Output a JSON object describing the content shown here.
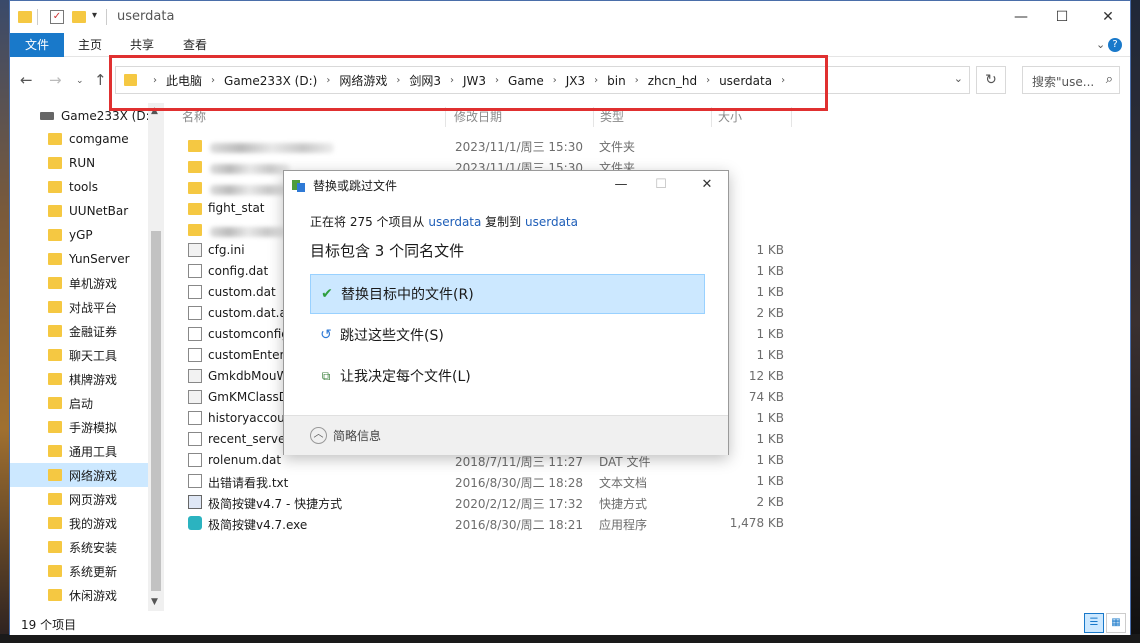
{
  "window": {
    "title": "userdata",
    "controls": {
      "minimize": "—",
      "maximize": "☐",
      "close": "✕"
    }
  },
  "ribbon": {
    "tabs": [
      "文件",
      "主页",
      "共享",
      "查看"
    ],
    "expand": "⌄",
    "help": "?"
  },
  "address_bar": {
    "crumbs": [
      "此电脑",
      "Game233X (D:)",
      "网络游戏",
      "剑网3",
      "JW3",
      "Game",
      "JX3",
      "bin",
      "zhcn_hd",
      "userdata"
    ],
    "search_placeholder": "搜索\"use...",
    "accent": "#e03030"
  },
  "nav": {
    "drive": "Game233X (D:)",
    "items": [
      "comgame",
      "RUN",
      "tools",
      "UUNetBar",
      "yGP",
      "YunServer",
      "单机游戏",
      "对战平台",
      "金融证券",
      "聊天工具",
      "棋牌游戏",
      "启动",
      "手游模拟",
      "通用工具",
      "网络游戏",
      "网页游戏",
      "我的游戏",
      "系统安装",
      "系统更新",
      "休闲游戏"
    ],
    "selected": "网络游戏"
  },
  "columns": {
    "name": "名称",
    "date": "修改日期",
    "type": "类型",
    "size": "大小"
  },
  "files": [
    {
      "name": "",
      "date": "2023/11/1/周三 15:30",
      "type": "文件夹",
      "size": "",
      "icon": "folder"
    },
    {
      "name": "",
      "date": "2023/11/1/周三 15:30",
      "type": "文件夹",
      "size": "",
      "icon": "folder"
    },
    {
      "name": "",
      "date": "",
      "type": "",
      "size": "",
      "icon": "folder"
    },
    {
      "name": "fight_stat",
      "date": "",
      "type": "",
      "size": "",
      "icon": "folder"
    },
    {
      "name": "",
      "date": "",
      "type": "",
      "size": "",
      "icon": "folder"
    },
    {
      "name": "cfg.ini",
      "date": "",
      "type": "",
      "size": "1 KB",
      "icon": "cfg"
    },
    {
      "name": "config.dat",
      "date": "",
      "type": "",
      "size": "1 KB",
      "icon": "file"
    },
    {
      "name": "custom.dat",
      "date": "",
      "type": "",
      "size": "1 KB",
      "icon": "file"
    },
    {
      "name": "custom.dat.ac",
      "date": "",
      "type": "",
      "size": "2 KB",
      "icon": "file"
    },
    {
      "name": "customconfig",
      "date": "",
      "type": "",
      "size": "1 KB",
      "icon": "file"
    },
    {
      "name": "customEnter.",
      "date": "",
      "type": "",
      "size": "1 KB",
      "icon": "file"
    },
    {
      "name": "GmkdbMouW",
      "date": "",
      "type": "",
      "size": "12 KB",
      "icon": "cfg"
    },
    {
      "name": "GmKMClassD",
      "date": "",
      "type": "",
      "size": "74 KB",
      "icon": "cfg"
    },
    {
      "name": "historyaccou",
      "date": "",
      "type": "",
      "size": "1 KB",
      "icon": "file"
    },
    {
      "name": "recent_server",
      "date": "",
      "type": "",
      "size": "1 KB",
      "icon": "file"
    },
    {
      "name": "rolenum.dat",
      "date": "2018/7/11/周三 11:27",
      "type": "DAT 文件",
      "size": "1 KB",
      "icon": "file"
    },
    {
      "name": "出错请看我.txt",
      "date": "2016/8/30/周二 18:28",
      "type": "文本文档",
      "size": "1 KB",
      "icon": "file"
    },
    {
      "name": "极简按键v4.7 - 快捷方式",
      "date": "2020/2/12/周三 17:32",
      "type": "快捷方式",
      "size": "2 KB",
      "icon": "lnk"
    },
    {
      "name": "极简按键v4.7.exe",
      "date": "2016/8/30/周二 18:21",
      "type": "应用程序",
      "size": "1,478 KB",
      "icon": "exe"
    }
  ],
  "status": {
    "count": "19 个项目"
  },
  "dialog": {
    "title": "替换或跳过文件",
    "copy_prefix": "正在将 275 个项目从 ",
    "source": "userdata",
    "copy_mid": " 复制到 ",
    "dest": "userdata",
    "conflict": "目标包含 3 个同名文件",
    "options": [
      {
        "label": "替换目标中的文件(R)",
        "icon": "check-icon"
      },
      {
        "label": "跳过这些文件(S)",
        "icon": "skip-icon"
      },
      {
        "label": "让我决定每个文件(L)",
        "icon": "decide-icon"
      }
    ],
    "more": "简略信息"
  }
}
